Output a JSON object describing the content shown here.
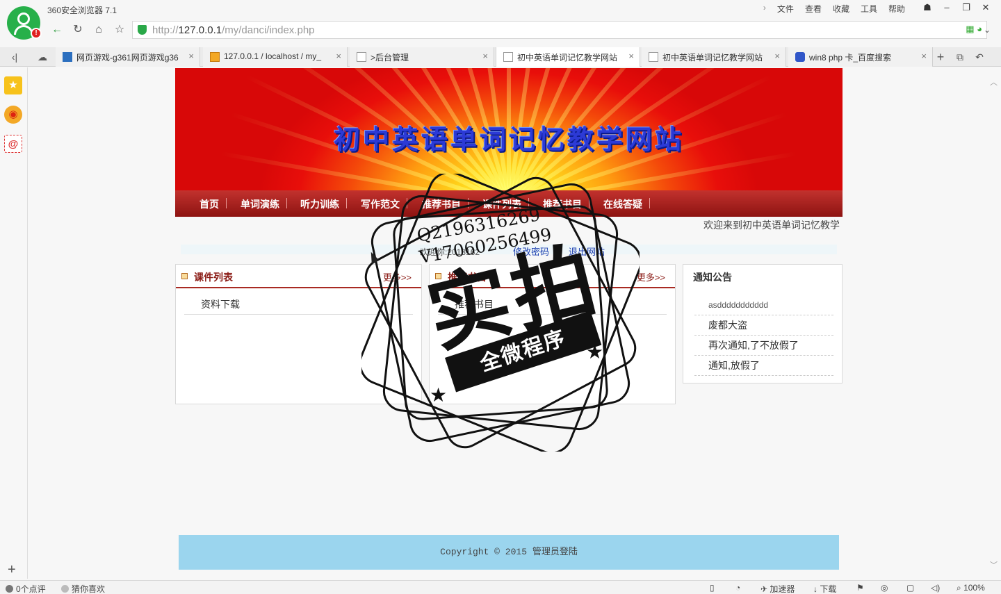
{
  "browser": {
    "title": "360安全浏览器 7.1",
    "menu": [
      "文件",
      "查看",
      "收藏",
      "工具",
      "帮助"
    ],
    "url_prefix": "http://",
    "url_host": "127.0.0.1",
    "url_path": "/my/danci/index.php",
    "tabs": [
      {
        "label": "网页游戏-g361网页游戏g36"
      },
      {
        "label": "127.0.0.1 / localhost / my_"
      },
      {
        "label": ">后台管理"
      },
      {
        "label": "初中英语单词记忆教学网站"
      },
      {
        "label": "初中英语单词记忆教学网站"
      },
      {
        "label": "win8 php 卡_百度搜索"
      }
    ],
    "status": {
      "comments": "0个点评",
      "guess": "猜你喜欢",
      "accelerator": "加速器",
      "download": "下载",
      "zoom": "100%"
    }
  },
  "site": {
    "banner_title": "初中英语单词记忆教学网站",
    "nav": [
      "首页",
      "单词演练",
      "听力训练",
      "写作范文",
      "推荐书目",
      "课件列表",
      "推荐书目",
      "在线答疑"
    ],
    "welcome": "欢迎来到初中英语单词记忆教学",
    "user_hello": "欢迎你:2013162",
    "change_password": "修改密码",
    "logout": "退出网站",
    "panels": [
      {
        "title": "课件列表",
        "more": "更多>>",
        "items": [
          "资料下载"
        ]
      },
      {
        "title": "推荐书目",
        "more": "更多>>",
        "items": [
          "推荐书目"
        ]
      }
    ],
    "notice": {
      "title": "通知公告",
      "items": [
        "asddddddddddd",
        "废都大盗",
        "再次通知,了不放假了",
        "通知,放假了"
      ]
    },
    "footer_copyright": "Copyright © 2015",
    "footer_admin": "管理员登陆"
  },
  "stamp": {
    "phone1": "Q2196316269",
    "phone2": "V17060256499",
    "big": "实拍",
    "ribbon": "全微程序"
  },
  "colors": {
    "nav_bg": "#a81d1a",
    "banner_title": "#2c3ad6",
    "footer_bg": "#9bd5ee",
    "accent_green": "#27b04a"
  }
}
